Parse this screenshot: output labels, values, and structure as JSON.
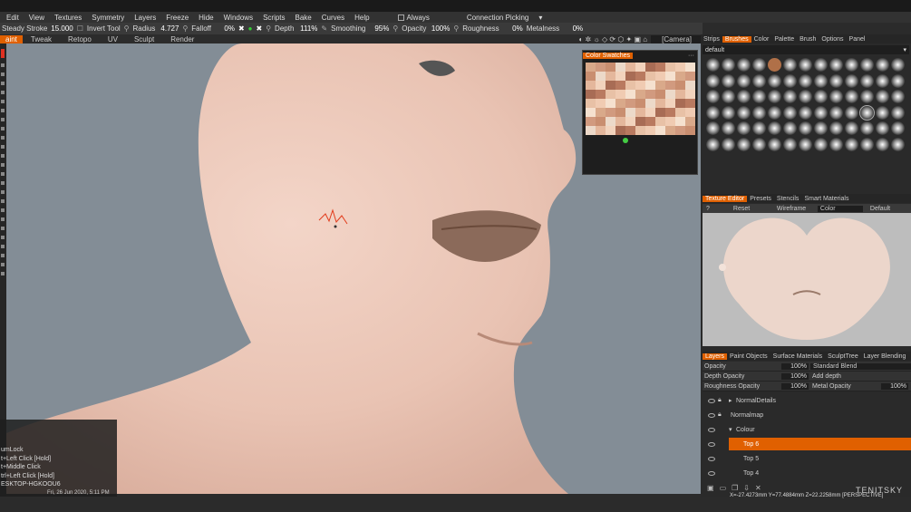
{
  "menu": [
    "Edit",
    "View",
    "Textures",
    "Symmetry",
    "Layers",
    "Freeze",
    "Hide",
    "Windows",
    "Scripts",
    "Bake",
    "Curves",
    "Help"
  ],
  "menu_extra": {
    "always": "Always",
    "connection": "Connection Picking"
  },
  "toolbar": {
    "steady_label": "Steady",
    "stroke_label": "Stroke",
    "stroke_val": "15.000",
    "invert_tool": "Invert Tool",
    "radius_label": "Radius",
    "radius_val": "4.727",
    "falloff_label": "Falloff",
    "falloff_val": "0%",
    "depth_label": "Depth",
    "depth_val": "111%",
    "smoothing_label": "Smoothing",
    "smoothing_val": "95%",
    "opacity_label": "Opacity",
    "opacity_val": "100%",
    "roughness_label": "Roughness",
    "roughness_val": "0%",
    "metalness_label": "Metalness",
    "metalness_val": "0%",
    "camera": "[Camera]"
  },
  "mode_tabs": [
    "aint",
    "Tweak",
    "Retopo",
    "UV",
    "Sculpt",
    "Render"
  ],
  "color_swatches_title": "Color Swatches",
  "right_tabs": [
    "Strips",
    "Brushes",
    "Color",
    "Palette",
    "Brush",
    "Options",
    "Panel"
  ],
  "brush_preset": "default",
  "texture_editor": {
    "tabs": [
      "Texture Editor",
      "Presets",
      "Stencils",
      "Smart Materials"
    ],
    "reset": "Reset",
    "wireframe": "Wireframe",
    "color": "Color",
    "default": "Default"
  },
  "layer_tabs": [
    "Layers",
    "Paint Objects",
    "Surface Materials",
    "SculptTree",
    "Layer Blending"
  ],
  "layer_props": {
    "opacity_label": "Opacity",
    "opacity_val": "100%",
    "blend": "Standard Blend",
    "depth_label": "Depth Opacity",
    "depth_val": "100%",
    "add": "Add",
    "depth_word": "depth",
    "rough_label": "Roughness Opacity",
    "rough_val": "100%",
    "metal_label": "Metal Opacity",
    "metal_val": "100%"
  },
  "layers": [
    "NormalDetails",
    "Normalmap",
    "Colour",
    "Top 6",
    "Top 5",
    "Top 4"
  ],
  "hotkeys": [
    "umLock",
    "t+Left Click [Hold]",
    "t+Middle Click",
    "trl+Left Click [Hold]",
    "ESKTOP-HGKOOU6"
  ],
  "datetime": "Fri, 26 Jun 2020, 5:11 PM",
  "watermark": "TENITSKY",
  "coords": "X=-27.4273mm Y=77.4884mm Z=22.2258mm [PERSPECTIVE]"
}
